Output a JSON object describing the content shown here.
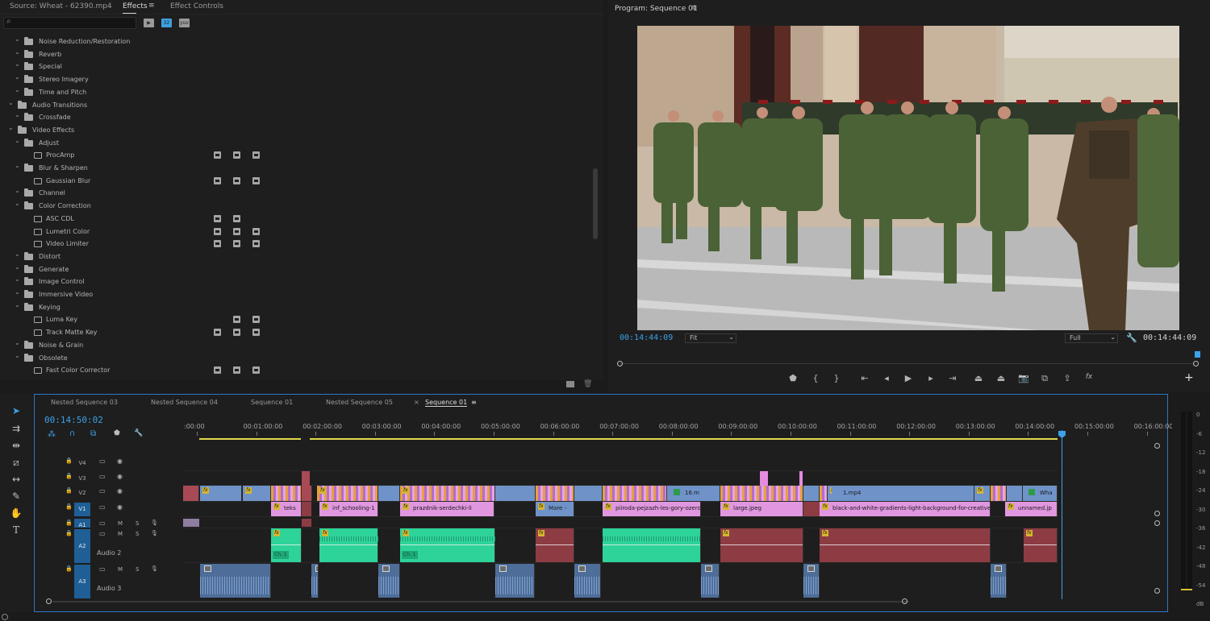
{
  "effects_panel": {
    "tabs": [
      "Source: Wheat - 62390.mp4",
      "Effects",
      "Effect Controls"
    ],
    "tree": [
      {
        "label": "Noise Reduction/Restoration",
        "kind": "folder",
        "level": 1
      },
      {
        "label": "Reverb",
        "kind": "folder",
        "level": 1
      },
      {
        "label": "Special",
        "kind": "folder",
        "level": 1
      },
      {
        "label": "Stereo Imagery",
        "kind": "folder",
        "level": 1
      },
      {
        "label": "Time and Pitch",
        "kind": "folder",
        "level": 1
      },
      {
        "label": "Audio Transitions",
        "kind": "folder",
        "level": 0
      },
      {
        "label": "Crossfade",
        "kind": "folder",
        "level": 1
      },
      {
        "label": "Video Effects",
        "kind": "folder",
        "level": 0
      },
      {
        "label": "Adjust",
        "kind": "folder",
        "level": 1
      },
      {
        "label": "ProcAmp",
        "kind": "effect",
        "level": 2,
        "badges": 3
      },
      {
        "label": "Blur & Sharpen",
        "kind": "folder",
        "level": 1
      },
      {
        "label": "Gaussian Blur",
        "kind": "effect",
        "level": 2,
        "badges": 3
      },
      {
        "label": "Channel",
        "kind": "folder",
        "level": 1
      },
      {
        "label": "Color Correction",
        "kind": "folder",
        "level": 1
      },
      {
        "label": "ASC CDL",
        "kind": "effect",
        "level": 2,
        "badges": 2
      },
      {
        "label": "Lumetri Color",
        "kind": "effect",
        "level": 2,
        "badges": 3
      },
      {
        "label": "Video Limiter",
        "kind": "effect",
        "level": 2,
        "badges": 3
      },
      {
        "label": "Distort",
        "kind": "folder",
        "level": 1
      },
      {
        "label": "Generate",
        "kind": "folder",
        "level": 1
      },
      {
        "label": "Image Control",
        "kind": "folder",
        "level": 1
      },
      {
        "label": "Immersive Video",
        "kind": "folder",
        "level": 1
      },
      {
        "label": "Keying",
        "kind": "folder",
        "level": 1
      },
      {
        "label": "Luma Key",
        "kind": "effect",
        "level": 2,
        "badges": 2
      },
      {
        "label": "Track Matte Key",
        "kind": "effect",
        "level": 2,
        "badges": 3
      },
      {
        "label": "Noise & Grain",
        "kind": "folder",
        "level": 1
      },
      {
        "label": "Obsolete",
        "kind": "folder",
        "level": 1
      },
      {
        "label": "Fast Color Corrector",
        "kind": "effect",
        "level": 2,
        "badges": 3
      }
    ]
  },
  "program_monitor": {
    "title": "Program: Sequence 01",
    "timecode_left": "00:14:44:09",
    "fit_label": "Fit",
    "quality_label": "Full",
    "timecode_right": "00:14:44:09",
    "controls": [
      "marker-icon",
      "in-point-icon",
      "out-point-icon",
      "go-to-in-icon",
      "step-back-icon",
      "play-icon",
      "step-forward-icon",
      "go-to-out-icon",
      "lift-icon",
      "extract-icon",
      "camera-icon",
      "compare-icon",
      "export-frame-icon",
      "fx-icon"
    ]
  },
  "timeline": {
    "tabs": [
      "Nested Sequence 03",
      "Nested Sequence 04",
      "Sequence 01",
      "Nested Sequence 05",
      "Sequence 01"
    ],
    "active_tab": 4,
    "close_glyph": "×",
    "timecode": "00:14:50:02",
    "ruler": [
      ":00:00",
      "00:01:00:00",
      "00:02:00:00",
      "00:03:00:00",
      "00:04:00:00",
      "00:05:00:00",
      "00:06:00:00",
      "00:07:00:00",
      "00:08:00:00",
      "00:09:00:00",
      "00:10:00:00",
      "00:11:00:00",
      "00:12:00:00",
      "00:13:00:00",
      "00:14:00:00",
      "00:15:00:00",
      "00:16:00:00"
    ],
    "video_tracks": [
      "V4",
      "V3",
      "V2",
      "V1"
    ],
    "audio_tracks": [
      {
        "id": "A1",
        "name": ""
      },
      {
        "id": "A2",
        "name": "Audio 2"
      },
      {
        "id": "A3",
        "name": "Audio 3"
      }
    ],
    "audio_buttons": [
      "M",
      "S"
    ],
    "v1_clip_labels": [
      "teks",
      "inf_schooling-1",
      "prazdnik-serdechki-li",
      "Mare -",
      "piiroda-pejzazh-les-gory-ozero-",
      "large.jpeg",
      "black-and-white-gradients-light-background-for-creative-pr",
      "unnamed.jp"
    ],
    "v2_clip_labels": [
      "16.m",
      "1.mp4",
      "Wha"
    ],
    "a2_clip_labels": [
      "Ch. 1",
      "Ch. 1"
    ],
    "fx_label": "fx"
  },
  "meter": {
    "scale": [
      "0",
      "-6",
      "-12",
      "-18",
      "-24",
      "-30",
      "-36",
      "-42",
      "-48",
      "-54",
      "dB"
    ]
  },
  "colors": {
    "accent_blue": "#3da1e8",
    "video_clip_blue": "#6f93c8",
    "video_clip_pink": "#e197e0",
    "audio_clip_green": "#2ed39a",
    "audio_clip_red": "#8d3c43",
    "audio_clip_slate": "#4e6e99"
  }
}
